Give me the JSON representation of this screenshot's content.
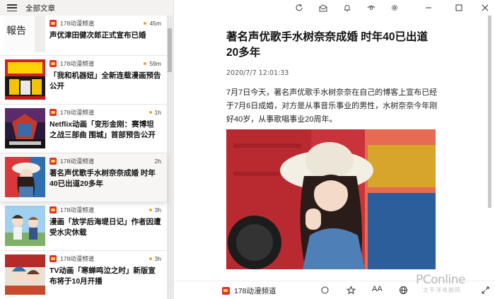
{
  "left_pane": {
    "title": "全部文章",
    "menu_icon": "hamburger-menu-icon"
  },
  "feed": [
    {
      "source": "178动漫频道",
      "time": "45m",
      "headline": "声优津田健次郎正式宣布已婚",
      "thumb_text": "報告",
      "unread": true
    },
    {
      "source": "178动漫频道",
      "time": "59m",
      "headline": "「我和机器妞」全新连载漫画预告公开",
      "unread": true
    },
    {
      "source": "178动漫频道",
      "time": "1h",
      "headline": "Netflix动画「变形金刚：赛博坦之战三部曲 围城」首部预告公开",
      "unread": true
    },
    {
      "source": "178动漫频道",
      "time": "2h",
      "headline": "著名声优歌手水树奈奈成婚 时年40已出道20多年",
      "unread": false,
      "selected": true
    },
    {
      "source": "178动漫频道",
      "time": "3h",
      "headline": "漫画「放学后海堤日记」作者因遭受水灾休载",
      "unread": true
    },
    {
      "source": "178动漫频道",
      "time": "3h",
      "headline": "TV动画「寒蝉鸣泣之时」新版宣布将于10月开播",
      "unread": true
    }
  ],
  "toolbar": {
    "icons": [
      "refresh-icon",
      "mark-all-read-icon",
      "bell-icon",
      "eye-icon",
      "settings-gear-icon",
      "minimize-icon",
      "maximize-icon",
      "close-icon"
    ]
  },
  "article": {
    "title": "著名声优歌手水树奈奈成婚 时年40已出道20多年",
    "date": "2020/7/7 12:01:33",
    "body": "7月7日今天，著名声优歌手水树奈奈在自己的博客上宣布已经于7月6日成婚，对方是从事音乐事业的男性，水树奈奈今年刚好40岁，从事歌唱事业20周年。"
  },
  "bottom_bar": {
    "source": "178动漫频道",
    "font_size_label": "AA",
    "icons": [
      "circle-icon",
      "star-icon",
      "font-size-icon",
      "globe-icon",
      "expand-icon"
    ]
  },
  "watermark": {
    "brand": "PConline",
    "sub": "太平洋电脑网"
  },
  "colors": {
    "accent_dot": "#f0a020",
    "source_icon": "#e03030"
  }
}
